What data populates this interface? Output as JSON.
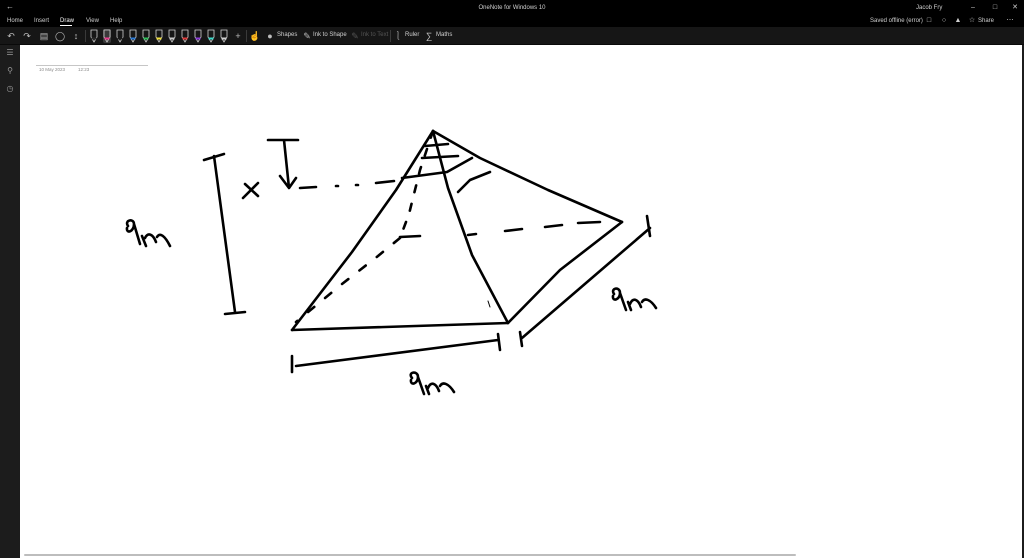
{
  "window": {
    "title": "OneNote for Windows 10",
    "user": "Jacob Fry",
    "back_icon": "back-arrow-icon",
    "minimize_icon": "minimize-icon",
    "maximize_icon": "maximize-icon",
    "close_icon": "close-icon"
  },
  "menu": {
    "tabs": [
      {
        "label": "Home"
      },
      {
        "label": "Insert"
      },
      {
        "label": "Draw",
        "active": true
      },
      {
        "label": "View"
      },
      {
        "label": "Help"
      }
    ],
    "saved_status": "Saved offline (error)",
    "share_label": "Share"
  },
  "toolbar": {
    "shapes_label": "Shapes",
    "ink_to_shape_label": "Ink to Shape",
    "ink_to_text_label": "Ink to Text",
    "ruler_label": "Ruler",
    "maths_label": "Maths",
    "pen_colors": [
      "#2b2b2b",
      "#e83c8c",
      "#1a1a1a",
      "#2b7bd8",
      "#2fbf5a",
      "#f4e23a",
      "#c8c8c8",
      "#e23a3a",
      "#8a3ad8",
      "#3ad8c8",
      "#d0d0d0"
    ]
  },
  "page": {
    "date": "10 May 2023",
    "time": "12:23"
  },
  "colors": {
    "ink": "#000000",
    "chrome_dark": "#000000",
    "toolbar_bg": "#161616"
  }
}
